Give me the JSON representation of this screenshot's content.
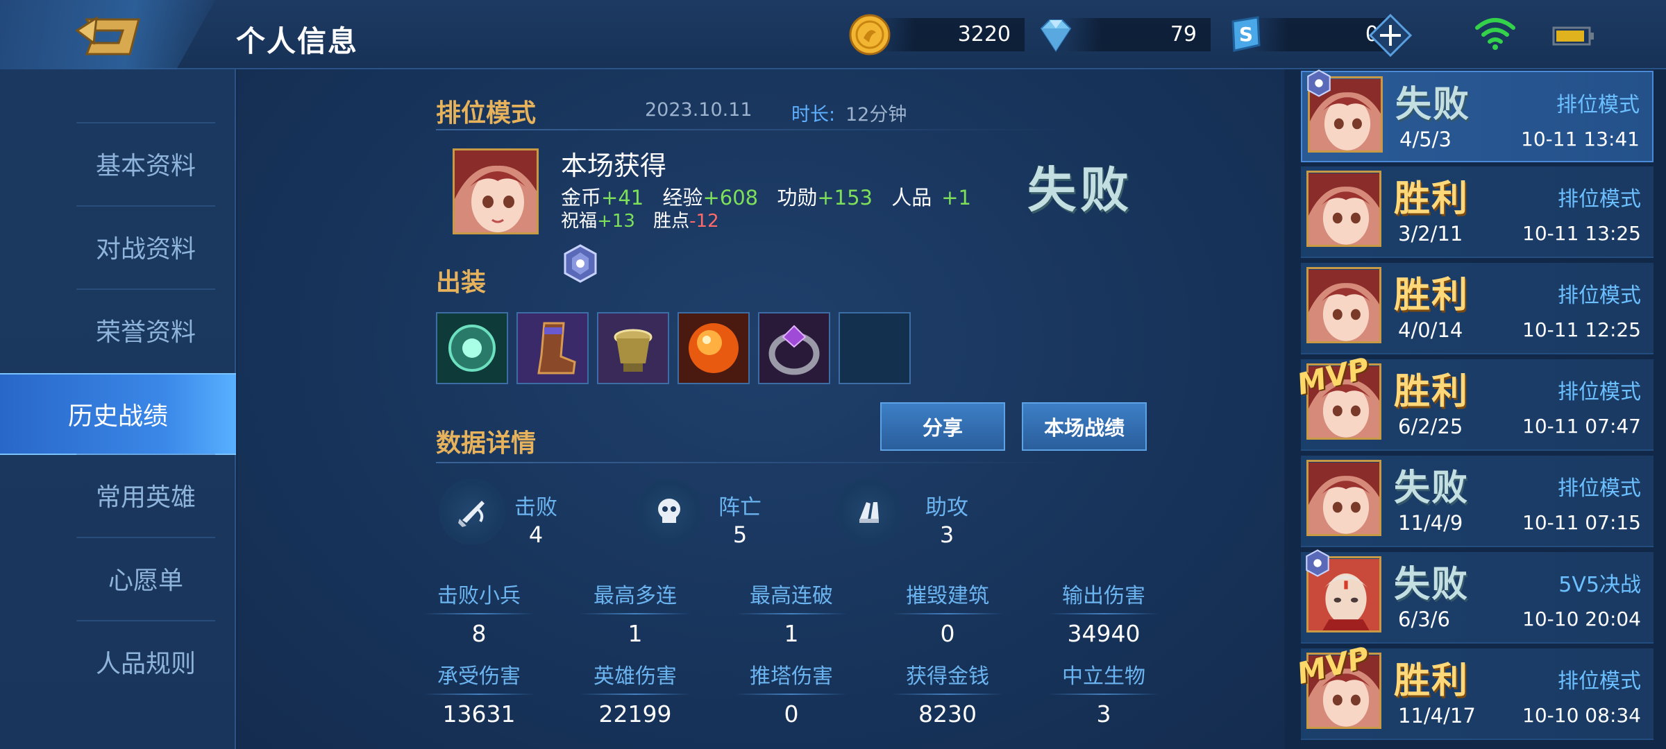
{
  "header": {
    "title": "个人信息",
    "gold": "3220",
    "diamond": "79",
    "voucher": "0"
  },
  "sidebar": {
    "items": [
      {
        "label": "基本资料"
      },
      {
        "label": "对战资料"
      },
      {
        "label": "荣誉资料"
      },
      {
        "label": "历史战绩",
        "active": true
      },
      {
        "label": "常用英雄"
      },
      {
        "label": "心愿单"
      },
      {
        "label": "人品规则"
      }
    ]
  },
  "match": {
    "mode": "排位模式",
    "date": "2023.10.11",
    "duration_label": "时长:",
    "duration": "12分钟",
    "earned_title": "本场获得",
    "rewards": {
      "gold_label": "金币",
      "gold": "+41",
      "exp_label": "经验",
      "exp": "+608",
      "merit_label": "功勋",
      "merit": "+153",
      "karma_label": "人品",
      "karma": "+1",
      "bless_label": "祝福",
      "bless": "+13",
      "points_label": "胜点",
      "points": "-12"
    },
    "result": "失败",
    "equipment_title": "出装",
    "equipment": [
      "green-orb-item",
      "boots-item",
      "golden-relic-item",
      "fire-orb-item",
      "purple-ring-item",
      "empty-slot"
    ],
    "share_label": "分享",
    "report_label": "本场战绩",
    "details_title": "数据详情",
    "kda": {
      "kills_label": "击败",
      "kills": "4",
      "deaths_label": "阵亡",
      "deaths": "5",
      "assists_label": "助攻",
      "assists": "3"
    },
    "stats": [
      {
        "label": "击败小兵",
        "value": "8"
      },
      {
        "label": "最高多连",
        "value": "1"
      },
      {
        "label": "最高连破",
        "value": "1"
      },
      {
        "label": "摧毁建筑",
        "value": "0"
      },
      {
        "label": "输出伤害",
        "value": "34940"
      },
      {
        "label": "承受伤害",
        "value": "13631"
      },
      {
        "label": "英雄伤害",
        "value": "22199"
      },
      {
        "label": "推塔伤害",
        "value": "0"
      },
      {
        "label": "获得金钱",
        "value": "8230"
      },
      {
        "label": "中立生物",
        "value": "3"
      }
    ]
  },
  "history": [
    {
      "result": "失败",
      "kda": "4/5/3",
      "mode": "排位模式",
      "time": "10-11 13:41",
      "mvp": false,
      "win": false
    },
    {
      "result": "胜利",
      "kda": "3/2/11",
      "mode": "排位模式",
      "time": "10-11 13:25",
      "mvp": false,
      "win": true
    },
    {
      "result": "胜利",
      "kda": "4/0/14",
      "mode": "排位模式",
      "time": "10-11 12:25",
      "mvp": false,
      "win": true
    },
    {
      "result": "胜利",
      "kda": "6/2/25",
      "mode": "排位模式",
      "time": "10-11 07:47",
      "mvp": true,
      "mvp_text": "MVP",
      "win": true
    },
    {
      "result": "失败",
      "kda": "11/4/9",
      "mode": "排位模式",
      "time": "10-11 07:15",
      "mvp": false,
      "win": false
    },
    {
      "result": "失败",
      "kda": "6/3/6",
      "mode": "5V5决战",
      "time": "10-10 20:04",
      "mvp": false,
      "win": false
    },
    {
      "result": "胜利",
      "kda": "11/4/17",
      "mode": "排位模式",
      "time": "10-10 08:34",
      "mvp": true,
      "mvp_text": "MVP",
      "win": true
    }
  ],
  "colors": {
    "accent_gold": "#e6b25c",
    "reward_green": "#7ee05a",
    "penalty_red": "#ff6a6a",
    "label_blue": "#6cb4f0"
  }
}
